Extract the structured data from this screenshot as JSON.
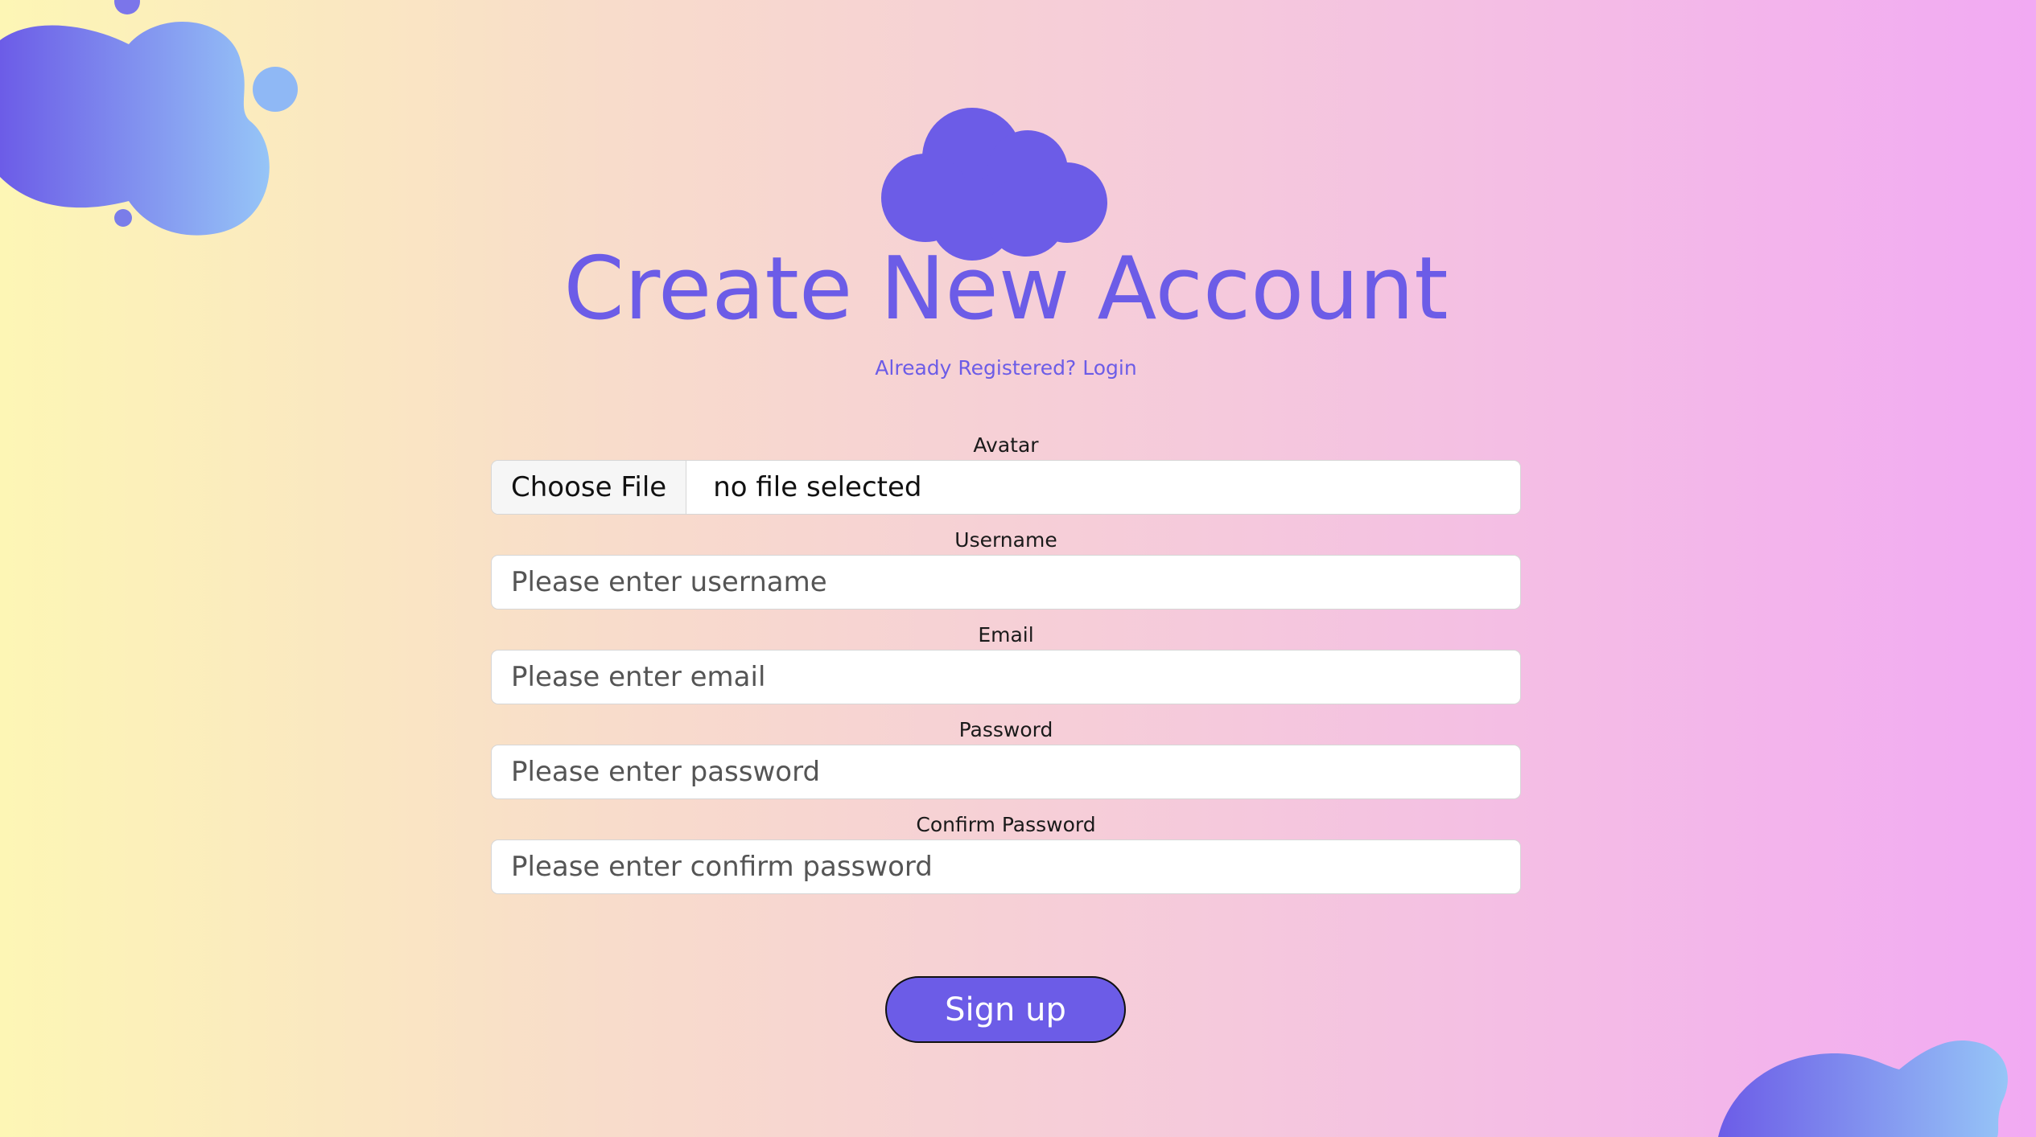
{
  "page": {
    "title": "Create New Account",
    "login_link": "Already Registered? Login",
    "accent_color": "#6c5ce7",
    "logo_icon": "cloud-icon"
  },
  "form": {
    "avatar": {
      "label": "Avatar",
      "button": "Choose File",
      "status": "no file selected"
    },
    "username": {
      "label": "Username",
      "placeholder": "Please enter username"
    },
    "email": {
      "label": "Email",
      "placeholder": "Please enter email"
    },
    "password": {
      "label": "Password",
      "placeholder": "Please enter password"
    },
    "confirm_password": {
      "label": "Confirm Password",
      "placeholder": "Please enter confirm password"
    },
    "submit": "Sign up"
  }
}
